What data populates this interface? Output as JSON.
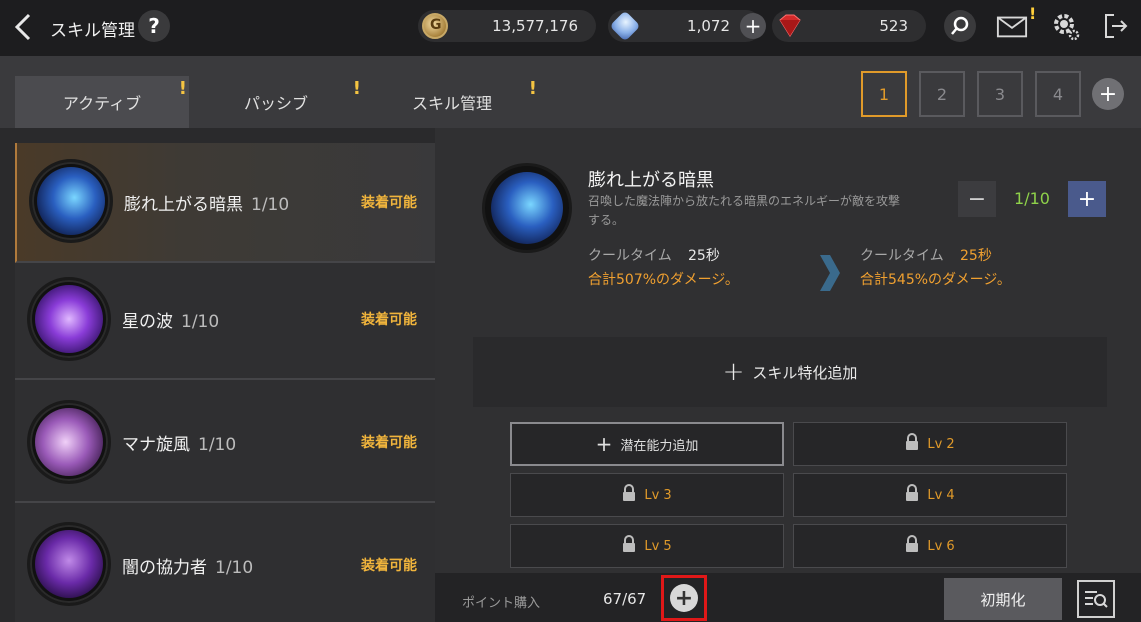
{
  "header": {
    "title": "スキル管理",
    "help_label": "?",
    "gold": "13,577,176",
    "crystal": "1,072",
    "ruby": "523",
    "badge": "!"
  },
  "tabs": [
    {
      "label": "アクティブ",
      "alert": "!"
    },
    {
      "label": "パッシブ",
      "alert": "!"
    },
    {
      "label": "スキル管理",
      "alert": "!"
    }
  ],
  "presets": [
    "1",
    "2",
    "3",
    "4"
  ],
  "skills": [
    {
      "name": "膨れ上がる暗黒",
      "level": "1/10",
      "status": "装着可能"
    },
    {
      "name": "星の波",
      "level": "1/10",
      "status": "装着可能"
    },
    {
      "name": "マナ旋風",
      "level": "1/10",
      "status": "装着可能"
    },
    {
      "name": "闇の協力者",
      "level": "1/10",
      "status": "装着可能"
    }
  ],
  "detail": {
    "title": "膨れ上がる暗黒",
    "description": "召喚した魔法陣から放たれる暗黒のエネルギーが敵を攻撃する。",
    "level": "1/10",
    "current": {
      "cooldown_label": "クールタイム",
      "cooldown_value": "25秒",
      "damage": "合計507%のダメージ。"
    },
    "next": {
      "cooldown_label": "クールタイム",
      "cooldown_value": "25秒",
      "damage": "合計545%のダメージ。"
    },
    "specialize_label": "スキル特化追加",
    "potentials": [
      {
        "label": "潜在能力追加"
      },
      {
        "label": "Lv 2"
      },
      {
        "label": "Lv 3"
      },
      {
        "label": "Lv 4"
      },
      {
        "label": "Lv 5"
      },
      {
        "label": "Lv 6"
      }
    ]
  },
  "bottom": {
    "points_label": "ポイント購入",
    "points_value": "67/67",
    "reset_label": "初期化"
  },
  "colors": {
    "accent": "#e09a2a",
    "equip": "#f0b43c",
    "level_green": "#8fd24a",
    "highlight_red": "#e01818"
  }
}
